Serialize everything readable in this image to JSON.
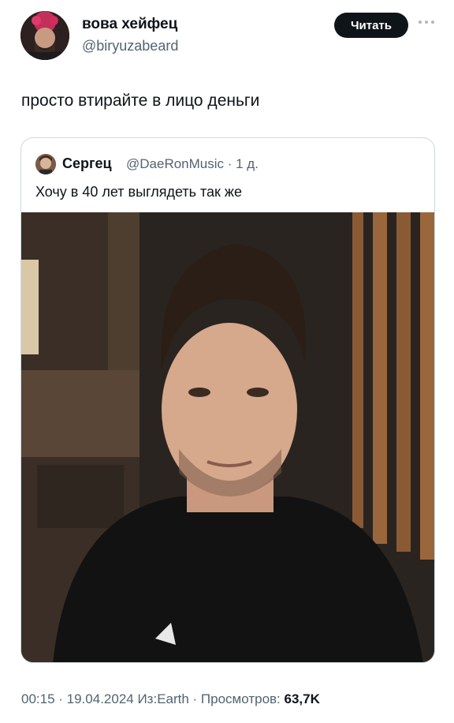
{
  "author": {
    "display_name": "вова хейфец",
    "handle": "@biryuzabeard",
    "avatar_icon": "user-avatar-icon"
  },
  "follow_label": "Читать",
  "tweet": {
    "text": "просто втирайте в лицо деньги"
  },
  "quoted_tweet": {
    "author_name": "Сергец",
    "handle_and_time": "@DaeRonMusic · 1 д.",
    "text": "Хочу в 40 лет выглядеть так же",
    "media_icon": "photo-portrait-icon"
  },
  "meta": {
    "timestamp": "00:15 · 19.04.2024 Из:Earth · Просмотров: ",
    "views": "63,7K"
  },
  "colors": {
    "text": "#0f1419",
    "secondary": "#536471",
    "border": "#cfd9de",
    "button_bg": "#0f1419"
  }
}
